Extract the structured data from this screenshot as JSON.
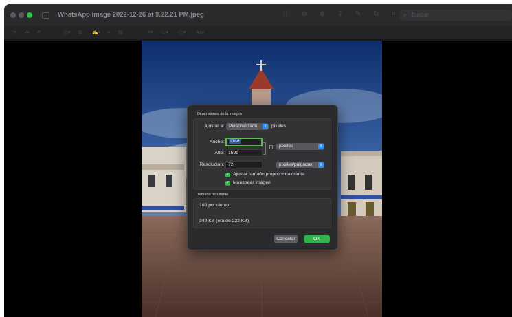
{
  "window": {
    "title": "WhatsApp Image 2022-12-26 at 9.22.21 PM.jpeg"
  },
  "toolbar": {
    "search_placeholder": "Buscar",
    "icons": [
      "info-icon",
      "zoom-out-icon",
      "zoom-in-icon",
      "share-icon",
      "markup-icon",
      "rotate-icon",
      "crop-icon",
      "annotate-icon"
    ],
    "markup_icons": [
      "selection-icon",
      "instant-alpha-icon",
      "sketch-icon",
      "shapes-icon",
      "text-icon",
      "sign-icon",
      "note-icon",
      "adjust-color-icon",
      "adjust-size-icon",
      "shape-style-icon",
      "border-color-icon",
      "fill-color-icon",
      "text-style-icon"
    ],
    "text_style_label": "Aa"
  },
  "dialog": {
    "section_dimensions": "Dimensiones de la imagen",
    "fit_label": "Ajustar a:",
    "fit_value": "Personalizado",
    "fit_unit": "pixeles",
    "width_label": "Ancho:",
    "width_value": "1186",
    "height_label": "Alto:",
    "height_value": "1599",
    "size_unit": "pixeles",
    "resolution_label": "Resolución:",
    "resolution_value": "72",
    "resolution_unit": "pixeles/pulgadas",
    "scale_proportionally_label": "Ajustar tamaño proporcionalmente",
    "scale_proportionally_checked": true,
    "resample_label": "Muestrear imagen",
    "resample_checked": true,
    "section_result": "Tamaño resultante",
    "result_percent": "100 por ciento",
    "result_size": "349 KB (era de 222 KB)",
    "cancel_label": "Cancelar",
    "ok_label": "OK",
    "accent_color": "#2fb34a",
    "popup_arrow_color": "#2f8bf7"
  }
}
